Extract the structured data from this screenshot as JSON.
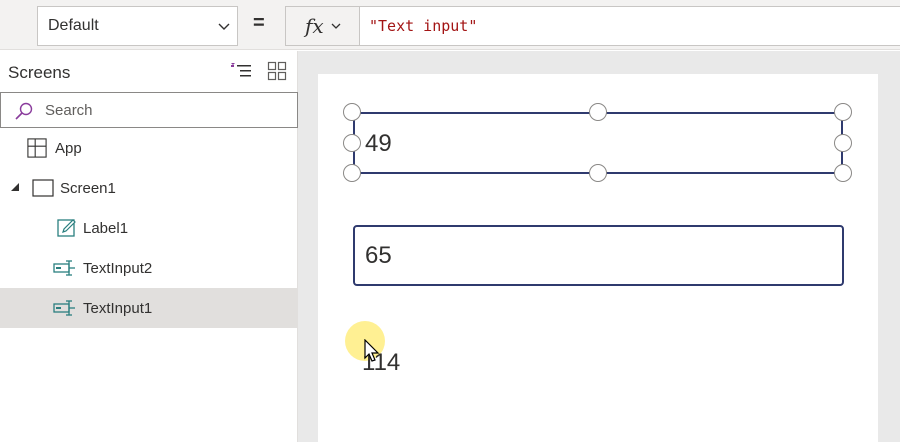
{
  "formula_bar": {
    "property_value": "Default",
    "equals": "=",
    "fx_label": "fx",
    "formula": "\"Text input\""
  },
  "left_panel": {
    "title": "Screens",
    "search_placeholder": "Search",
    "items": [
      {
        "label": "App",
        "icon": "app-icon"
      },
      {
        "label": "Screen1",
        "icon": "screen-icon"
      },
      {
        "label": "Label1",
        "icon": "label-icon"
      },
      {
        "label": "TextInput2",
        "icon": "text-input-icon"
      },
      {
        "label": "TextInput1",
        "icon": "text-input-icon",
        "selected": true
      }
    ]
  },
  "canvas": {
    "label1_text": "49",
    "textinput2_value": "65",
    "textinput1_value": "114"
  },
  "colors": {
    "selection_border": "#2f3a6e",
    "formula_string": "#a31515",
    "accent_purple": "#8a3c9c",
    "icon_teal": "#2a7f7f",
    "selected_row": "#e1dfdd"
  }
}
